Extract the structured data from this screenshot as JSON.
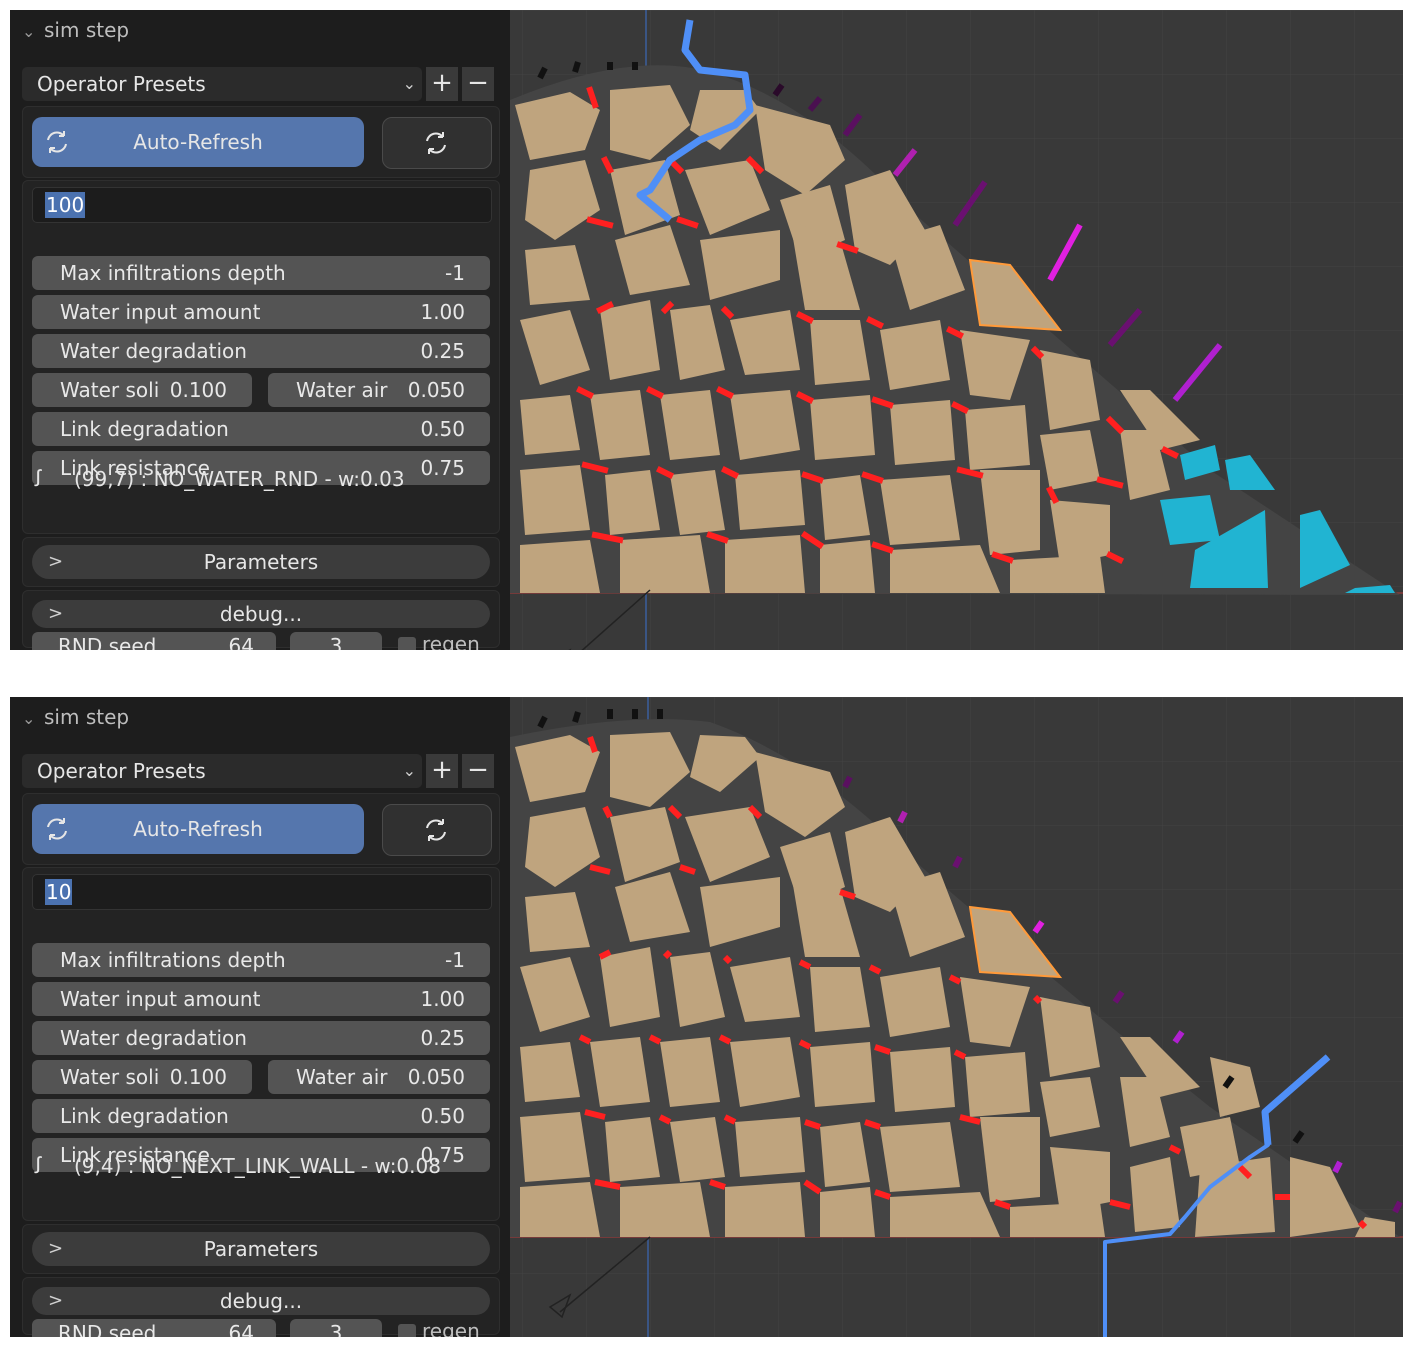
{
  "colors": {
    "accent": "#5576ad",
    "stone": "#bfa47e",
    "link": "#ff2020",
    "water_path": "#4f8ff7",
    "wet_stone": "#21b4d2",
    "selected_outline": "#ff9a3a",
    "viewport_bg": "#393939",
    "panel_bg": "#1d1d1d"
  },
  "screens": [
    {
      "panel": {
        "title": "sim step",
        "presets_label": "Operator Presets",
        "add_icon": "+",
        "remove_icon": "−",
        "auto_refresh_label": "Auto-Refresh",
        "refresh_icon": "refresh-icon",
        "step_value": "100",
        "fields": [
          {
            "label": "Max infiltrations depth",
            "value": "-1"
          },
          {
            "label": "Water input amount",
            "value": "1.00"
          },
          {
            "label": "Water degradation",
            "value": "0.25"
          }
        ],
        "water_soil": {
          "label": "Water soli",
          "value": "0.100"
        },
        "water_air": {
          "label": "Water air",
          "value": "0.050"
        },
        "fields2": [
          {
            "label": "Link degradation",
            "value": "0.50"
          },
          {
            "label": "Link resistance",
            "value": "0.75"
          }
        ],
        "status_icon": "ꭍ",
        "status_text": "(99,7) : NO_WATER_RND - w:0.03",
        "parameters_label": "Parameters",
        "debug_label": "debug...",
        "seed": {
          "label": "RND seed",
          "value": "64",
          "extra": "3",
          "regen_label": "regen"
        }
      },
      "viewport": {
        "water_path_variant": "top"
      }
    },
    {
      "panel": {
        "title": "sim step",
        "presets_label": "Operator Presets",
        "add_icon": "+",
        "remove_icon": "−",
        "auto_refresh_label": "Auto-Refresh",
        "refresh_icon": "refresh-icon",
        "step_value": "10",
        "fields": [
          {
            "label": "Max infiltrations depth",
            "value": "-1"
          },
          {
            "label": "Water input amount",
            "value": "1.00"
          },
          {
            "label": "Water degradation",
            "value": "0.25"
          }
        ],
        "water_soil": {
          "label": "Water soli",
          "value": "0.100"
        },
        "water_air": {
          "label": "Water air",
          "value": "0.050"
        },
        "fields2": [
          {
            "label": "Link degradation",
            "value": "0.50"
          },
          {
            "label": "Link resistance",
            "value": "0.75"
          }
        ],
        "status_icon": "ꭍ",
        "status_text": "(9,4) : NO_NEXT_LINK_WALL - w:0.08",
        "parameters_label": "Parameters",
        "debug_label": "debug...",
        "seed": {
          "label": "RND seed",
          "value": "64",
          "extra": "3",
          "regen_label": "regen"
        }
      },
      "viewport": {
        "water_path_variant": "bottom"
      }
    }
  ]
}
